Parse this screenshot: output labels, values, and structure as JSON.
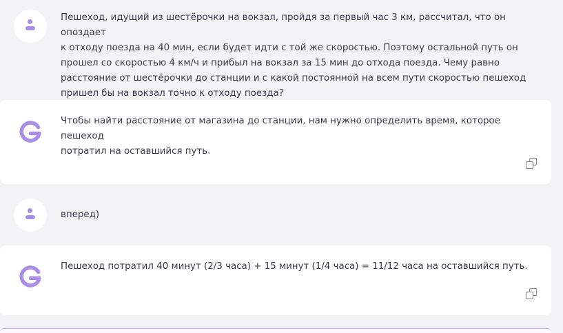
{
  "messages": [
    {
      "role": "user",
      "avatar_icon": "user-icon",
      "text": "Пешеход, идущий из шестёрочки на вокзал, пройдя за первый час 3 км, рассчитал, что он опоздает\nк отходу поезда на 40 мин, если будет идти с той же скоростью. Поэтому остальной путь он\nпрошел со скоростью 4 км/ч и прибыл на вокзал за 15 мин до отхода поезда. Чему равно\nрасстояние от шестёрочки до станции и с какой постоянной на всем пути скоростью пешеход\nпришел бы на вокзал точно к отходу поезда?"
    },
    {
      "role": "assistant",
      "avatar_icon": "g-logo-icon",
      "text": "Чтобы найти расстояние от магазина до станции, нам нужно определить время, которое пешеход\nпотратил на оставшийся путь.",
      "copy_icon": "copy-icon"
    },
    {
      "role": "user",
      "avatar_icon": "user-icon",
      "text": "вперед)"
    },
    {
      "role": "assistant",
      "avatar_icon": "g-logo-icon",
      "text": "Пешеход потратил 40 минут (2/3 часа) + 15 минут (1/4 часа) = 11/12 часа на оставшийся путь.",
      "copy_icon": "copy-icon"
    }
  ],
  "colors": {
    "background": "#f3f3f6",
    "card": "#ffffff",
    "accent": "#a98ee6",
    "text": "#3a3a48"
  }
}
